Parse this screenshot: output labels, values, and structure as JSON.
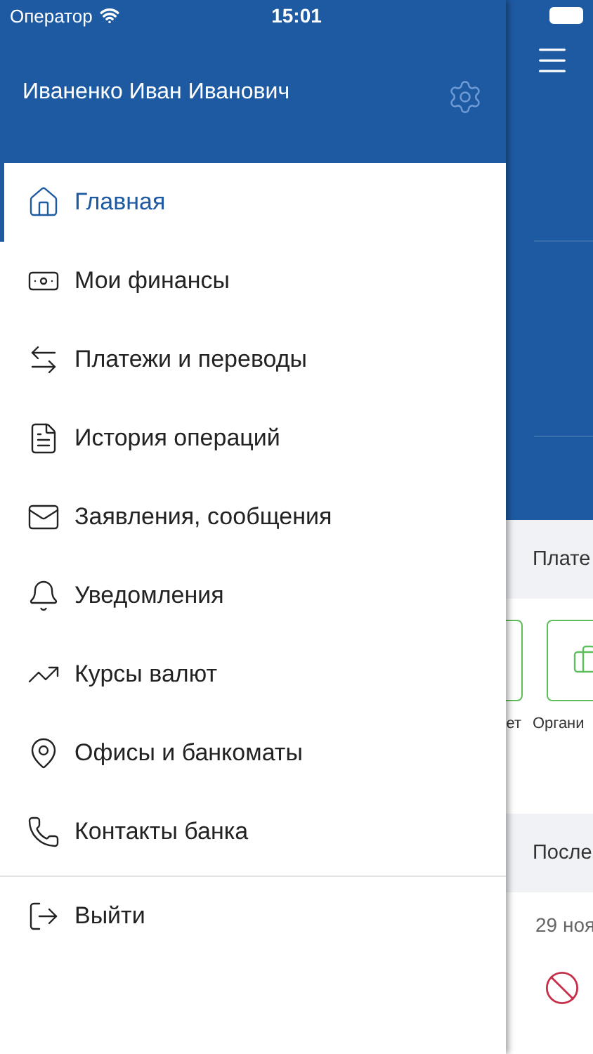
{
  "status_bar": {
    "carrier": "Оператор",
    "time": "15:01"
  },
  "user": {
    "name": "Иваненко Иван Иванович"
  },
  "menu": [
    {
      "label": "Главная",
      "selected": true
    },
    {
      "label": "Мои финансы",
      "selected": false
    },
    {
      "label": "Платежи и переводы",
      "selected": false
    },
    {
      "label": "История операций",
      "selected": false
    },
    {
      "label": "Заявления, сообщения",
      "selected": false
    },
    {
      "label": "Уведомления",
      "selected": false
    },
    {
      "label": "Курсы валют",
      "selected": false
    },
    {
      "label": "Офисы и банкоматы",
      "selected": false
    },
    {
      "label": "Контакты банка",
      "selected": false
    }
  ],
  "logout": {
    "label": "Выйти"
  },
  "background_screen": {
    "payments_header": "Плате",
    "tiles": [
      {
        "label": "ет"
      },
      {
        "label": "Органи"
      }
    ],
    "recent_header": "После",
    "date": "29 ноя"
  }
}
